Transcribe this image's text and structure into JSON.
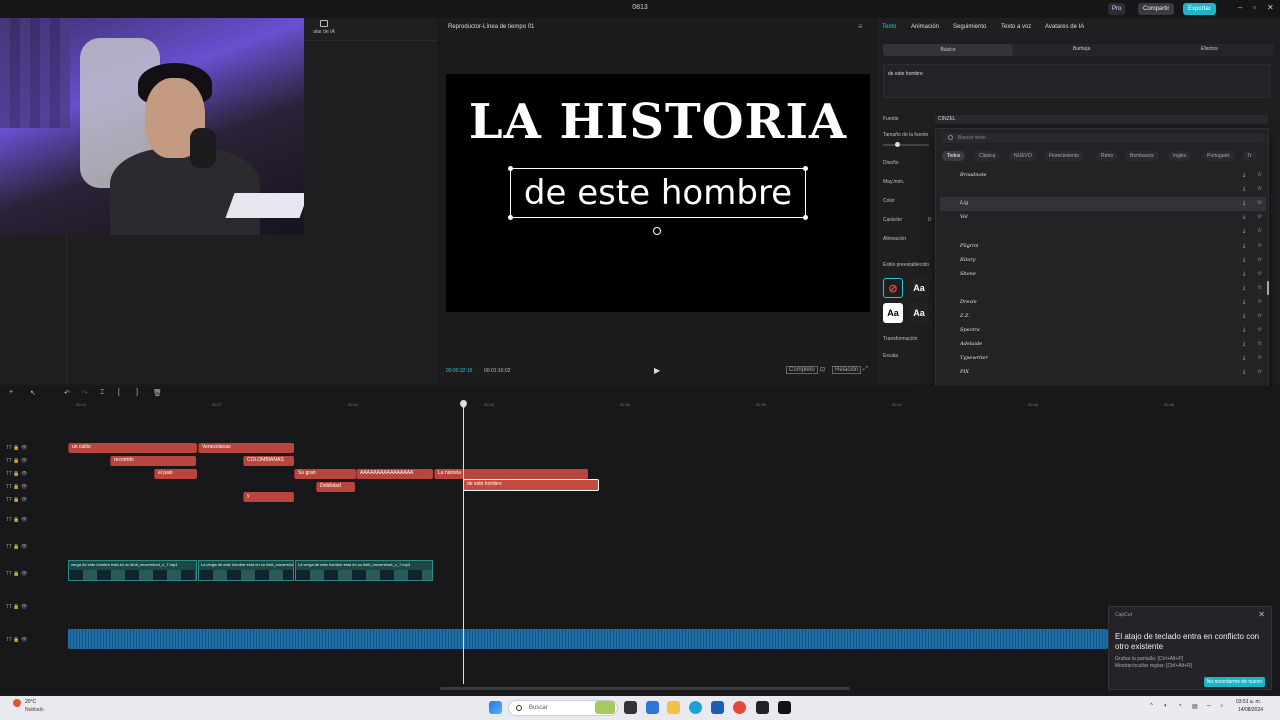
{
  "window": {
    "title": "0813",
    "pro_label": "Pro",
    "share_label": "Compartir",
    "export_label": "Exportar"
  },
  "media_panel": {
    "ia_tab_label": "atar de IA"
  },
  "player": {
    "title": "Reproductor-Línea de tiempo 01",
    "headline": "LA HISTORIA",
    "subtitle": "de este hombre",
    "time_current": "00:00:32:16",
    "time_total": "00:01:10:02",
    "controls": [
      "Completo",
      "Relación"
    ]
  },
  "text_panel": {
    "tabs": [
      "Texto",
      "Animación",
      "Seguimiento",
      "Texto a voz",
      "Avatares de IA"
    ],
    "subtabs": [
      "Básico",
      "Burbuja",
      "Efectos"
    ],
    "text_value": "de este hombre",
    "labels": {
      "font": "Fuente",
      "font_size": "Tamaño de la fuente",
      "design": "Diseño",
      "case": "May./min.",
      "color": "Color",
      "character": "Carácter",
      "alignment": "Alineación",
      "preset": "Estilo preestablecido",
      "transform": "Transformación",
      "scale": "Escala"
    },
    "character_value": "0",
    "font_value": "CINZEL",
    "preset_labels": [
      "Aa",
      "Aa",
      "Aa"
    ]
  },
  "font_dropdown": {
    "search_placeholder": "Buscar texto",
    "filters": [
      "Todos",
      "Clásica",
      "NUEVO",
      "Florecimiento",
      "Retro",
      "Bombazos",
      "Inglés",
      "Portugués",
      "Tr"
    ],
    "fonts": [
      "Broadnote",
      "",
      "L/g",
      "Vol",
      "",
      "Pilgrim",
      "Ritory",
      "Sbone",
      "",
      "Drexle",
      "Z.Z.",
      "Spectra",
      "Adelaide",
      "Typewriter",
      "PIX"
    ]
  },
  "timeline": {
    "ticks": [
      "00:24",
      "00:27",
      "00:30",
      "00:33",
      "00:36",
      "00:39",
      "00:42",
      "00:45",
      "00:48"
    ],
    "text_clips": [
      {
        "label": "un culito",
        "row": 0
      },
      {
        "label": "Venezolanas",
        "row": 0
      },
      {
        "label": "recorrido",
        "row": 1
      },
      {
        "label": "COLOMBIANAS",
        "row": 1
      },
      {
        "label": "el pais",
        "row": 2
      },
      {
        "label": "Su gran",
        "row": 2
      },
      {
        "label": "AAAAAAAAAAAAAAAA",
        "row": 2
      },
      {
        "label": "La historia",
        "row": 2
      },
      {
        "label": "Debilidad",
        "row": 3
      },
      {
        "label": "de este hombre",
        "row": 3
      },
      {
        "label": "y",
        "row": 4
      }
    ],
    "video_clips": [
      "verga de este hombre esta en su limit_muvershort_v_7.mp4",
      "La verga de este hombre esta en su limit_muvershort_v_7.mp4",
      "La verga de este hombre esta en su limit_muvershort_v_7.mp4"
    ]
  },
  "toast": {
    "app": "CapCut",
    "message": "El atajo de teclado entra en conflicto con otro existente",
    "detail": "Grabar la pantalla: [Ctrl+Alt+P]\nMostrar/ocultar reglas: [Ctrl+Alt+R]",
    "button": "No recordarme de nuevo"
  },
  "taskbar": {
    "temp": "20°C",
    "weather": "Nublado",
    "search_placeholder": "Buscar",
    "time": "03:51 a. m.",
    "date": "14/08/2024"
  }
}
